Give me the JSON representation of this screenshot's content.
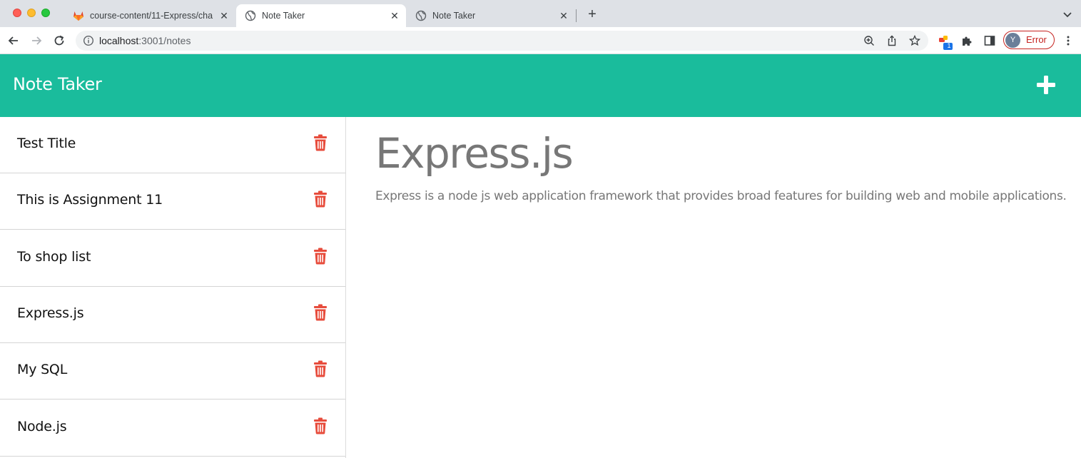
{
  "browser": {
    "tabs": [
      {
        "title": "course-content/11-Express/cha",
        "icon": "gitlab-icon",
        "active": false
      },
      {
        "title": "Note Taker",
        "icon": "globe-icon",
        "active": true
      },
      {
        "title": "Note Taker",
        "icon": "globe-icon",
        "active": false
      }
    ],
    "url_host": "localhost",
    "url_path": ":3001/notes",
    "profile_initial": "Y",
    "profile_status": "Error",
    "extension_badge": "1"
  },
  "app": {
    "title": "Note Taker",
    "header_color": "#1abc9c",
    "delete_color": "#e74c3c"
  },
  "notes": [
    {
      "title": "Test Title"
    },
    {
      "title": "This is Assignment 11"
    },
    {
      "title": "To shop list"
    },
    {
      "title": "Express.js"
    },
    {
      "title": "My SQL"
    },
    {
      "title": "Node.js"
    }
  ],
  "active_note": {
    "title": "Express.js",
    "text": "Express is a node js web application framework that provides broad features for building web and mobile applications."
  }
}
